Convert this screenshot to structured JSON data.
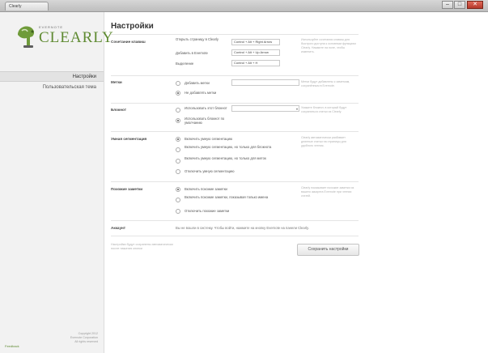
{
  "window": {
    "tab_label": "Clearly",
    "min_glyph": "–",
    "max_glyph": "□",
    "close_glyph": "✕"
  },
  "sidebar": {
    "logo_top": "EVERNOTE",
    "logo_main": "CLEARLY",
    "items": [
      {
        "label": "Настройки",
        "active": true
      },
      {
        "label": "Пользовательская тема",
        "active": false
      }
    ],
    "footer_lines": [
      "Copyright 2012",
      "Evernote Corporation",
      "All rights reserved"
    ],
    "footer_link": "Feedback"
  },
  "main": {
    "title": "Настройки",
    "hotkeys": {
      "label": "Сочетание клавиш",
      "rows": [
        {
          "label": "Открыть страницу в Clearly",
          "value": "Control + Alt + Right Arrow"
        },
        {
          "label": "Добавить в Evernote",
          "value": "Control + Alt + Up Arrow"
        },
        {
          "label": "Выделение",
          "value": "Control + Alt + H"
        }
      ],
      "note": "Используйте сочетания клавиш для быстрого доступа к основным функциям Clearly. Нажмите на поле, чтобы изменить."
    },
    "tags": {
      "label": "Метки",
      "options": [
        "Добавить метки",
        "Не добавлять метки"
      ],
      "selected": 1,
      "note": "Метки будут добавлены к заметкам, сохранённым в Evernote."
    },
    "notebook": {
      "label": "Блокнот",
      "options": [
        "Использовать этот блокнот",
        "Использовать блокнот по умолчанию"
      ],
      "selected": 1,
      "select_arrow": "▾",
      "note": "Укажите блокнот, в который будут сохраняться статьи из Clearly."
    },
    "highlights": {
      "label": "Умная сегментация",
      "options": [
        "Включить умную сегментацию",
        "Включить умную сегментацию, но только для блокнота",
        "Включить умную сегментацию, но только для меток",
        "Отключить умную сегментацию"
      ],
      "selected": 0,
      "note": "Clearly автоматически разбивает длинные статьи на страницы для удобного чтения."
    },
    "related": {
      "label": "Похожие заметки",
      "options": [
        "Включить похожие заметки",
        "Включить похожие заметки, показывая только имена",
        "Отключить похожие заметки"
      ],
      "selected": 0,
      "note": "Clearly показывает похожие заметки из вашего аккаунта Evernote при чтении статей."
    },
    "account": {
      "label": "Аккаунт",
      "text": "Вы не вошли в систему. Чтобы войти, нажмите на кнопку Evernote на панели Clearly."
    },
    "bottom_note": [
      "Настройки будут сохранены автоматически",
      "после нажатия кнопки"
    ],
    "save_label": "Сохранить настройки"
  }
}
